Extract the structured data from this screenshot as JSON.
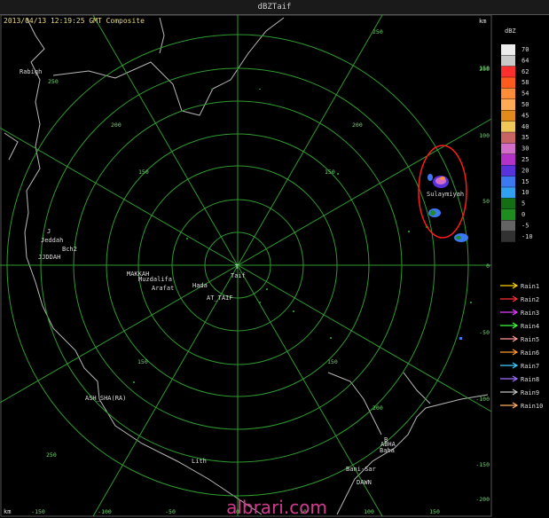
{
  "window": {
    "title": "dBZTaif"
  },
  "header": {
    "timestamp": "2013/04/13 12:19:25 GMT Composite",
    "unit_right": "km",
    "unit_bottom": "km"
  },
  "scale_labels": {
    "right": [
      "200",
      "150",
      "100",
      "50",
      "0",
      "-50",
      "-100",
      "-150",
      "-200"
    ],
    "bottom": [
      "-150",
      "-100",
      "-50",
      "0",
      "50",
      "100",
      "150"
    ],
    "rings": [
      "250",
      "200",
      "150",
      "100",
      "50"
    ]
  },
  "places": {
    "taif_marker": "T",
    "taif": "Taif",
    "rabigh": "Rabigh",
    "jeddah_marker": "J",
    "jeddah": "Jeddah",
    "bch2": "Bch2",
    "jddah": "JJDDAH",
    "makkah": "MAKKAH",
    "muzdalifa": "Muzdalifa",
    "arafat": "Arafat",
    "hada": "Hada",
    "at_taif": "AT_TAIF",
    "sulaymiyah": "Sulaymiyah",
    "ash_sharaim": "ASH_SHA(RA)",
    "lith": "Lith",
    "baha_marker": "B",
    "baha_code": "ABHA",
    "baha": "Baha",
    "bani_sar": "Bani-Sar",
    "dawn": "DAWN"
  },
  "legend": {
    "title": "dBZ",
    "colors": [
      "#ececec",
      "#c9c9c9",
      "#ff2f2f",
      "#ff5a1e",
      "#ff8c38",
      "#ffaa55",
      "#e28a1c",
      "#f0c85a",
      "#c86464",
      "#d26ec8",
      "#b432c8",
      "#5a32dc",
      "#3c78f0",
      "#32a0f0",
      "#146e14",
      "#1e8c1e",
      "#646464",
      "#323232"
    ],
    "levels": [
      "70",
      "64",
      "62",
      "58",
      "54",
      "50",
      "45",
      "40",
      "35",
      "30",
      "25",
      "20",
      "15",
      "10",
      "5",
      "0",
      "-5",
      "-10"
    ]
  },
  "gauges": {
    "labels": [
      "Rain1",
      "Rain2",
      "Rain3",
      "Rain4",
      "Rain5",
      "Rain6",
      "Rain7",
      "Rain8",
      "Rain9",
      "Rain10"
    ],
    "colors": [
      "#ffd400",
      "#ff3030",
      "#e040ff",
      "#40ff40",
      "#ff9a9a",
      "#ff9a30",
      "#40d0ff",
      "#a070ff",
      "#c0c0c0",
      "#ffb060"
    ]
  },
  "annotation": {
    "color": "#ff1a1a"
  },
  "watermark": "albrari.com"
}
